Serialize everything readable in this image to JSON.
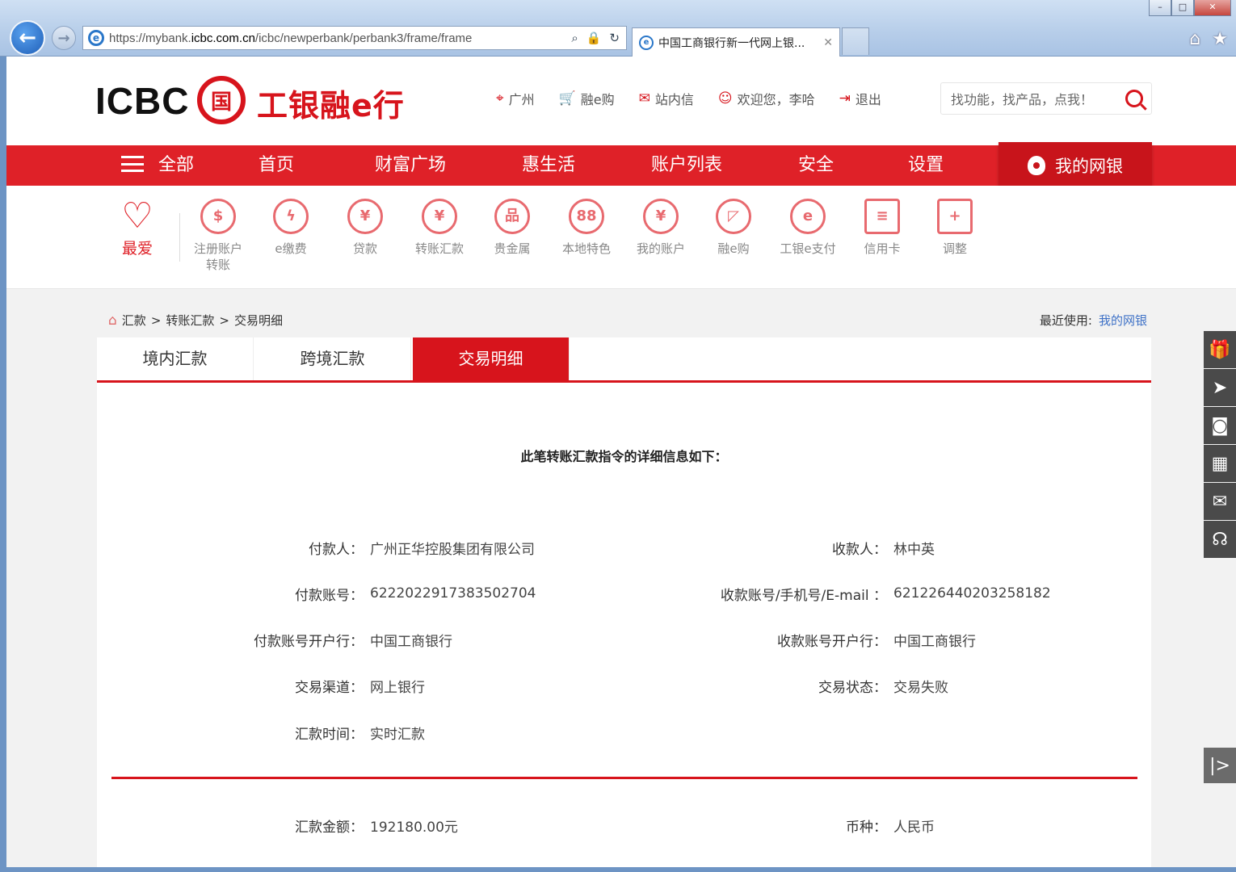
{
  "browser": {
    "url_prefix": "https://mybank.",
    "url_domain": "icbc.com.cn",
    "url_path": "/icbc/newperbank/perbank3/frame/frame",
    "tab_title": "中国工商银行新一代网上银...",
    "tab_close": "✕",
    "back_glyph": "←",
    "forward_glyph": "→",
    "home_glyph": "⌂",
    "star_glyph": "★",
    "addr_icons": [
      "search-icon",
      "lock-icon",
      "refresh-icon"
    ]
  },
  "header": {
    "logo_text": "ICBC",
    "logo_mark": "国",
    "logo_cn": "工银融e行",
    "links": {
      "location": "广州",
      "shop": "融e购",
      "messages": "站内信",
      "welcome": "欢迎您，李哈",
      "logout": "退出"
    },
    "search_placeholder": "找功能，找产品，点我！"
  },
  "nav": {
    "all": "全部",
    "home": "首页",
    "wealth": "财富广场",
    "life": "惠生活",
    "accounts": "账户列表",
    "security": "安全",
    "settings": "设置",
    "mybank": "我的网银"
  },
  "quick": {
    "favorite": "最爱",
    "items": [
      {
        "label1": "注册账户",
        "label2": "转账",
        "icon": "coin-icon",
        "glyph": "$"
      },
      {
        "label1": "e缴费",
        "label2": "",
        "icon": "drop-bolt-icon",
        "glyph": "ϟ"
      },
      {
        "label1": "贷款",
        "label2": "",
        "icon": "money-bag-icon",
        "glyph": "¥"
      },
      {
        "label1": "转账汇款",
        "label2": "",
        "icon": "transfer-icon",
        "glyph": "¥"
      },
      {
        "label1": "贵金属",
        "label2": "",
        "icon": "gold-bars-icon",
        "glyph": "品"
      },
      {
        "label1": "本地特色",
        "label2": "",
        "icon": "local-icon",
        "glyph": "88"
      },
      {
        "label1": "我的账户",
        "label2": "",
        "icon": "account-icon",
        "glyph": "¥"
      },
      {
        "label1": "融e购",
        "label2": "",
        "icon": "shopping-bag-icon",
        "glyph": "◸"
      },
      {
        "label1": "工银e支付",
        "label2": "",
        "icon": "epay-icon",
        "glyph": "e"
      },
      {
        "label1": "信用卡",
        "label2": "",
        "icon": "credit-card-icon",
        "glyph": "≡"
      },
      {
        "label1": "调整",
        "label2": "",
        "icon": "plus-icon",
        "glyph": "+"
      }
    ]
  },
  "breadcrumb": {
    "home_glyph": "⌂",
    "l1": "汇款",
    "sep": ">",
    "l2": "转账汇款",
    "l3": "交易明细"
  },
  "recent": {
    "label": "最近使用:",
    "link": "我的网银"
  },
  "tabs": {
    "domestic": "境内汇款",
    "crossborder": "跨境汇款",
    "details": "交易明细"
  },
  "detail": {
    "title": "此笔转账汇款指令的详细信息如下：",
    "payer_label": "付款人：",
    "payer": "广州正华控股集团有限公司",
    "payee_label": "收款人：",
    "payee": "林中英",
    "payer_account_label": "付款账号：",
    "payer_account": "6222022917383502704",
    "payee_account_label": "收款账号/手机号/E-mail ：",
    "payee_account": "6212264402032581​82",
    "payer_bank_label": "付款账号开户行：",
    "payer_bank": "中国工商银行",
    "payee_bank_label": "收款账号开户行：",
    "payee_bank": "中国工商银行",
    "channel_label": "交易渠道：",
    "channel": "网上银行",
    "status_label": "交易状态：",
    "status": "交易失败",
    "time_label": "汇款时间：",
    "time": "实时汇款",
    "amount_label": "汇款金额：",
    "amount": "192180.00元",
    "currency_label": "币种：",
    "currency": "人民币"
  },
  "sidebar": {
    "buttons": [
      {
        "name": "gift-icon",
        "glyph": "🎁"
      },
      {
        "name": "send-icon",
        "glyph": "➤"
      },
      {
        "name": "camera-icon",
        "glyph": "◙"
      },
      {
        "name": "calendar-icon",
        "glyph": "▦"
      },
      {
        "name": "mail-icon",
        "glyph": "✉"
      },
      {
        "name": "support-icon",
        "glyph": "☊"
      }
    ],
    "toggle": "|>"
  },
  "colors": {
    "brand_red": "#d7141c",
    "nav_red": "#df2128",
    "link_blue": "#3f72c7"
  }
}
